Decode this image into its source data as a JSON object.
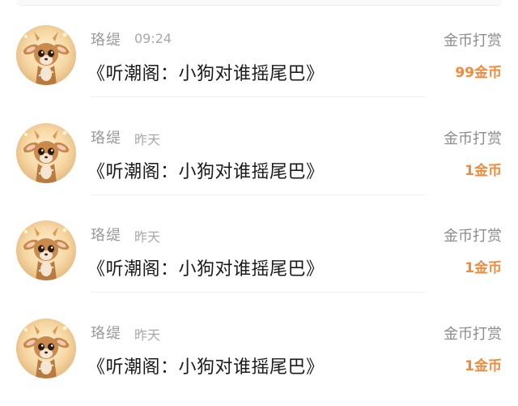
{
  "messages": [
    {
      "user": "珞缇",
      "time": "09:24",
      "title": "《听潮阁：小狗对谁摇尾巴》",
      "reward_label": "金币打赏",
      "reward_amount": "99金币",
      "avatar_icon": "fawn-avatar"
    },
    {
      "user": "珞缇",
      "time": "昨天",
      "title": "《听潮阁：小狗对谁摇尾巴》",
      "reward_label": "金币打赏",
      "reward_amount": "1金币",
      "avatar_icon": "fawn-avatar"
    },
    {
      "user": "珞缇",
      "time": "昨天",
      "title": "《听潮阁：小狗对谁摇尾巴》",
      "reward_label": "金币打赏",
      "reward_amount": "1金币",
      "avatar_icon": "fawn-avatar"
    },
    {
      "user": "珞缇",
      "time": "昨天",
      "title": "《听潮阁：小狗对谁摇尾巴》",
      "reward_label": "金币打赏",
      "reward_amount": "1金币",
      "avatar_icon": "fawn-avatar"
    }
  ],
  "colors": {
    "accent": "#f08a3c",
    "username": "#9a9a9a",
    "timestamp": "#a8a8a8",
    "title": "#1a1a1a",
    "label": "#8c8c8c"
  }
}
